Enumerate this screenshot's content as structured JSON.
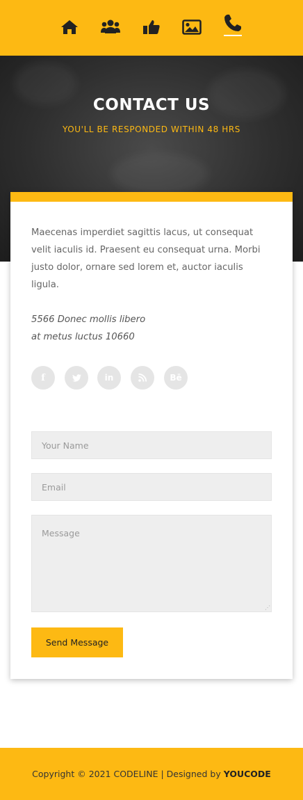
{
  "nav": {
    "items": [
      {
        "id": "home",
        "icon": "home-icon",
        "active": false
      },
      {
        "id": "team",
        "icon": "users-icon",
        "active": false
      },
      {
        "id": "likes",
        "icon": "thumbs-up-icon",
        "active": false
      },
      {
        "id": "gallery",
        "icon": "image-icon",
        "active": false
      },
      {
        "id": "contact",
        "icon": "phone-icon",
        "active": true
      }
    ],
    "accent": "#fdb913"
  },
  "hero": {
    "title": "CONTACT US",
    "subtitle": "YOU'LL BE RESPONDED WITHIN 48 HRS"
  },
  "contact": {
    "description": "Maecenas imperdiet sagittis lacus, ut consequat velit iaculis id. Praesent eu consequat urna. Morbi justo dolor, ornare sed lorem et, auctor iaculis ligula.",
    "address_line1": "5566 Donec mollis libero",
    "address_line2": "at metus luctus 10660",
    "social": [
      {
        "name": "facebook-icon",
        "glyph": "f"
      },
      {
        "name": "twitter-icon",
        "glyph": "t"
      },
      {
        "name": "linkedin-icon",
        "glyph": "in"
      },
      {
        "name": "rss-icon",
        "glyph": "rss"
      },
      {
        "name": "behance-icon",
        "glyph": "Bē"
      }
    ]
  },
  "form": {
    "name_placeholder": "Your Name",
    "email_placeholder": "Email",
    "message_placeholder": "Message",
    "submit_label": "Send Message"
  },
  "footer": {
    "copyright": "Copyright © 2021 CODELINE | Designed by",
    "designer": "YOUCODE"
  }
}
